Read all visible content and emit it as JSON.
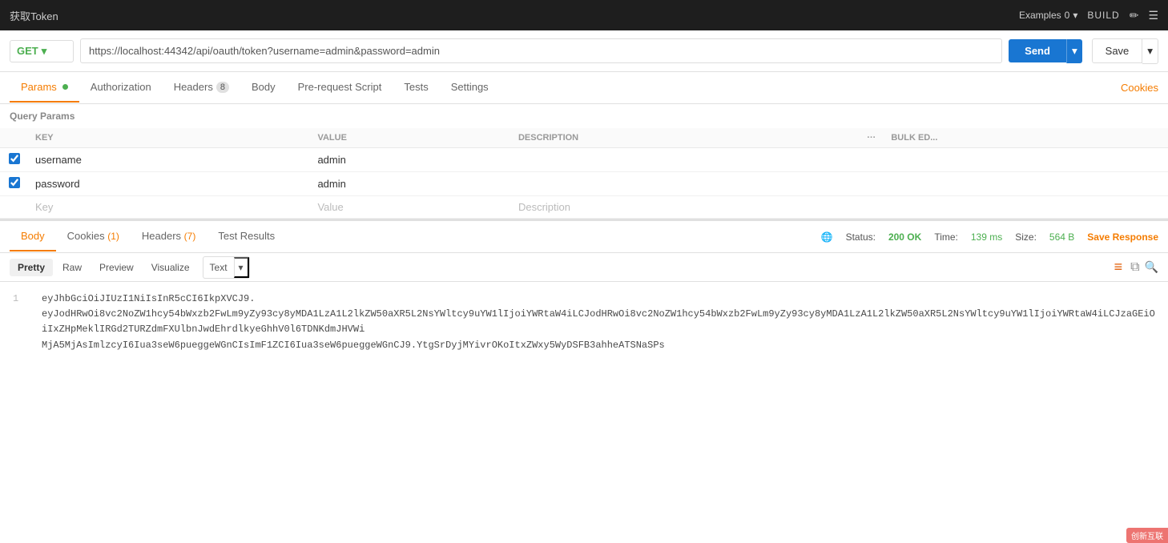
{
  "topbar": {
    "title": "获取Token",
    "examples_label": "Examples",
    "examples_count": "0",
    "build_label": "BUILD"
  },
  "urlbar": {
    "method": "GET",
    "url": "https://localhost:44342/api/oauth/token?username=admin&password=admin",
    "send_label": "Send",
    "save_label": "Save"
  },
  "tabs": [
    {
      "id": "params",
      "label": "Params",
      "badge": "",
      "dot": true,
      "active": true
    },
    {
      "id": "authorization",
      "label": "Authorization",
      "badge": "",
      "dot": false,
      "active": false
    },
    {
      "id": "headers",
      "label": "Headers",
      "badge": "8",
      "dot": false,
      "active": false
    },
    {
      "id": "body",
      "label": "Body",
      "badge": "",
      "dot": false,
      "active": false
    },
    {
      "id": "prerequest",
      "label": "Pre-request Script",
      "badge": "",
      "dot": false,
      "active": false
    },
    {
      "id": "tests",
      "label": "Tests",
      "badge": "",
      "dot": false,
      "active": false
    },
    {
      "id": "settings",
      "label": "Settings",
      "badge": "",
      "dot": false,
      "active": false
    }
  ],
  "cookies_right": "Cookies",
  "query_params_label": "Query Params",
  "params_table": {
    "columns": [
      "KEY",
      "VALUE",
      "DESCRIPTION"
    ],
    "rows": [
      {
        "checked": true,
        "key": "username",
        "value": "admin",
        "description": ""
      },
      {
        "checked": true,
        "key": "password",
        "value": "admin",
        "description": ""
      }
    ],
    "placeholder_row": {
      "key": "Key",
      "value": "Value",
      "description": "Description"
    },
    "bulk_edit_label": "Bulk Ed..."
  },
  "response": {
    "tabs": [
      {
        "id": "body",
        "label": "Body",
        "active": true
      },
      {
        "id": "cookies",
        "label": "Cookies",
        "count": "1",
        "active": false
      },
      {
        "id": "headers",
        "label": "Headers",
        "count": "7",
        "active": false
      },
      {
        "id": "test_results",
        "label": "Test Results",
        "active": false
      }
    ],
    "status_label": "Status:",
    "status_value": "200 OK",
    "time_label": "Time:",
    "time_value": "139 ms",
    "size_label": "Size:",
    "size_value": "564 B",
    "save_response_label": "Save Response",
    "format_buttons": [
      {
        "id": "pretty",
        "label": "Pretty",
        "active": true
      },
      {
        "id": "raw",
        "label": "Raw",
        "active": false
      },
      {
        "id": "preview",
        "label": "Preview",
        "active": false
      },
      {
        "id": "visualize",
        "label": "Visualize",
        "active": false
      }
    ],
    "text_label": "Text",
    "line1": "eyJhbGciOiJIUzI1NiIsInR5cCI6IkpXVCJ9.",
    "line2": "eyJodHRwOi8vc2NoZW1hcy54bWxzb2FwLm9yZy93cy8yMDA1LzA1L2lkZW50aXR5L2NsYWltcy9uYW1lIjoiYWRtaW4iLCJodHRwOi8vc2NoZW1hcy54bWxzb2FwLm9yZy93cy8yMDA1LzA1L2lkZW50aXR5L2NsYWltcy9uYW1lIjoiYWRtaW4iLCJzaGEiOiIxZHpMeklIRGd2TURZdmFXUlbnJwdEhrdlkyeGhhV0l6TDNKdmJHVWi",
    "line3": "MjA5MjAsImlzcyI6Iua3seW6pueggeWGnCIsImF1ZCI6Iua3seW6pueggeWGnCJ9.YtgSrDyjMYivrOKoItxZWxy5WyDSFB3ahheATSNaSPs"
  },
  "watermark": "创新互联"
}
